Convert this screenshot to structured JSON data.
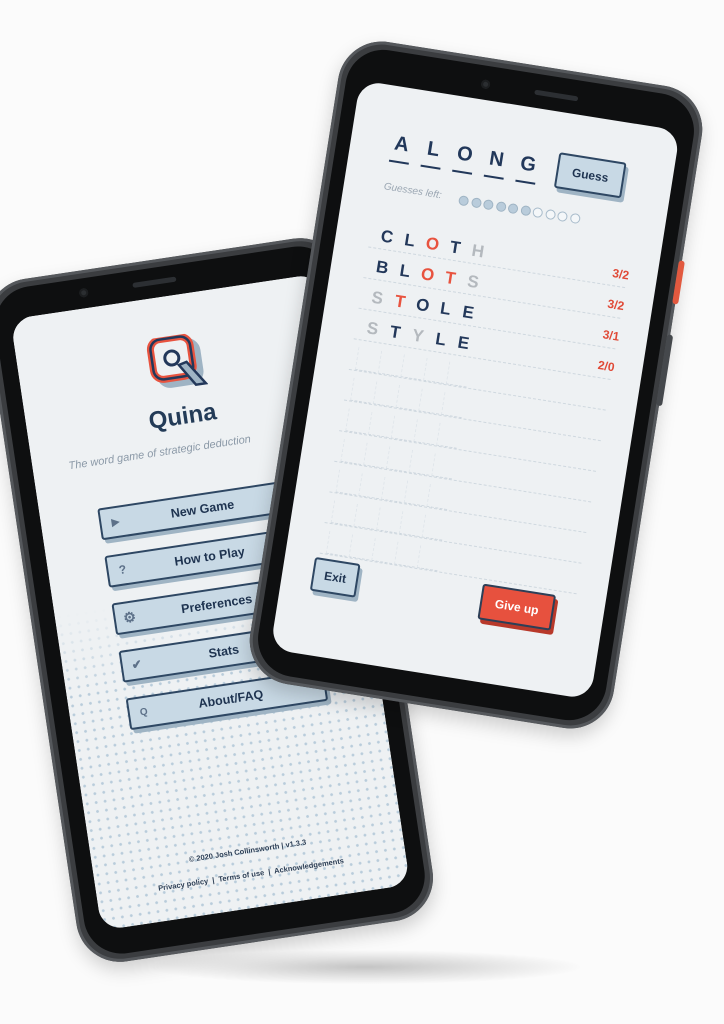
{
  "menu_screen": {
    "app_title": "Quina",
    "tagline": "The word game of strategic deduction",
    "menu_items": [
      {
        "label": "New Game",
        "icon": "play-icon"
      },
      {
        "label": "How to Play",
        "icon": "question-icon"
      },
      {
        "label": "Preferences",
        "icon": "gear-icon"
      },
      {
        "label": "Stats",
        "icon": "check-circle-icon"
      },
      {
        "label": "About/FAQ",
        "icon": "q-logo-icon"
      }
    ],
    "copyright": "© 2020 Josh Collinsworth",
    "version": "v1.3.3",
    "footer_links": [
      "Privacy policy",
      "Terms of use",
      "Acknowledgements"
    ]
  },
  "game_screen": {
    "current_guess": [
      "A",
      "L",
      "O",
      "N",
      "G"
    ],
    "guess_button": "Guess",
    "guesses_left_label": "Guesses left:",
    "guesses_total": 10,
    "guesses_remaining": 6,
    "guess_rows": [
      {
        "letters": [
          {
            "ch": "C",
            "state": "navy"
          },
          {
            "ch": "L",
            "state": "navy"
          },
          {
            "ch": "O",
            "state": "red"
          },
          {
            "ch": "T",
            "state": "navy"
          },
          {
            "ch": "H",
            "state": "grey"
          }
        ],
        "score": "3/2"
      },
      {
        "letters": [
          {
            "ch": "B",
            "state": "navy"
          },
          {
            "ch": "L",
            "state": "navy"
          },
          {
            "ch": "O",
            "state": "red"
          },
          {
            "ch": "T",
            "state": "red"
          },
          {
            "ch": "S",
            "state": "grey"
          }
        ],
        "score": "3/2"
      },
      {
        "letters": [
          {
            "ch": "S",
            "state": "grey"
          },
          {
            "ch": "T",
            "state": "red"
          },
          {
            "ch": "O",
            "state": "navy"
          },
          {
            "ch": "L",
            "state": "navy"
          },
          {
            "ch": "E",
            "state": "navy"
          }
        ],
        "score": "3/1"
      },
      {
        "letters": [
          {
            "ch": "S",
            "state": "grey"
          },
          {
            "ch": "T",
            "state": "navy"
          },
          {
            "ch": "Y",
            "state": "grey"
          },
          {
            "ch": "L",
            "state": "navy"
          },
          {
            "ch": "E",
            "state": "navy"
          }
        ],
        "score": "2/0"
      }
    ],
    "exit_button": "Exit",
    "give_up_button": "Give up"
  },
  "colors": {
    "navy": "#23385a",
    "accent_red": "#e8533f",
    "button_fill": "#c8d9e5",
    "screen_bg": "#eef1f3",
    "phone_body": "#3b3d40"
  }
}
